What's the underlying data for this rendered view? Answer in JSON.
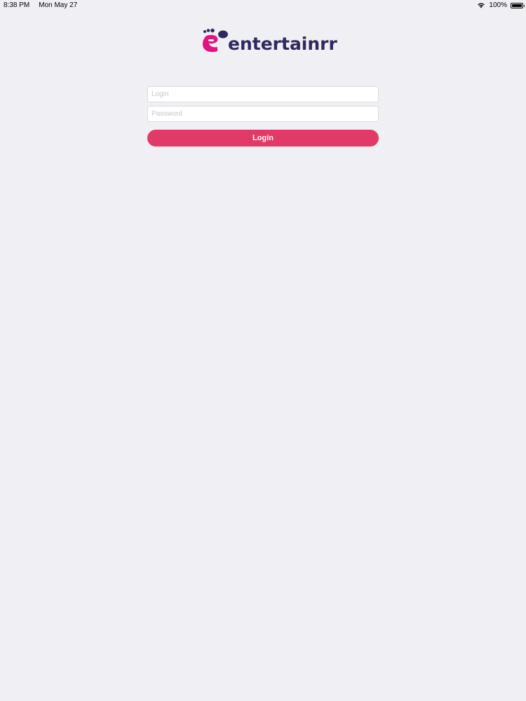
{
  "status_bar": {
    "time": "8:38 PM",
    "date": "Mon May 27",
    "battery_percent": "100%",
    "battery_level": 1.0
  },
  "logo": {
    "text": "entertainrr",
    "text_color": "#2e2a5e",
    "mark_color_primary": "#e0157f",
    "mark_color_secondary": "#2e2a5e"
  },
  "form": {
    "login_placeholder": "Login",
    "login_value": "",
    "password_placeholder": "Password",
    "password_value": "",
    "submit_label": "Login"
  },
  "colors": {
    "background": "#f0eff4",
    "accent": "#e23a66"
  }
}
